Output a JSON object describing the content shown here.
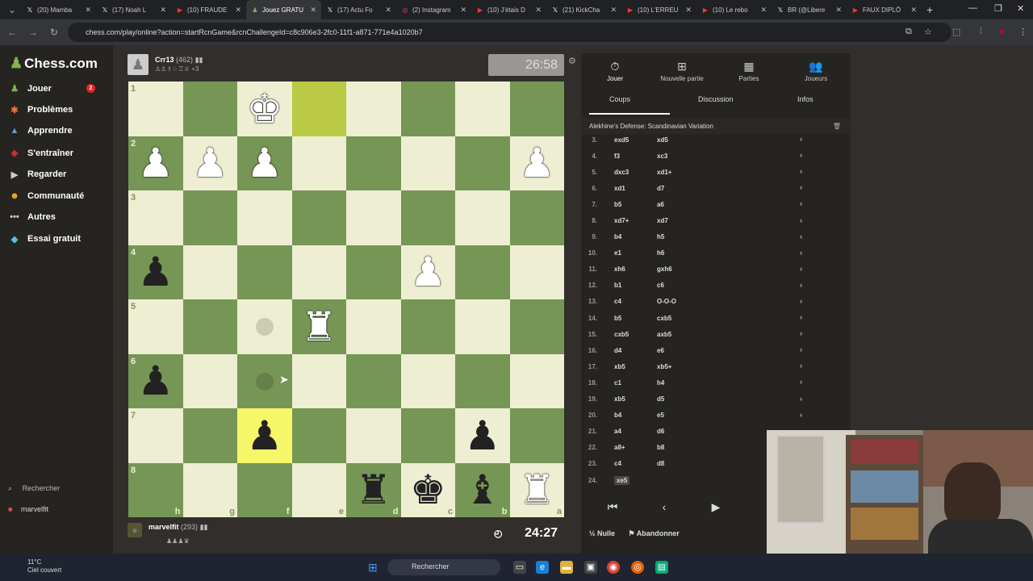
{
  "browser": {
    "tabs": [
      {
        "icon": "x-icon",
        "title": "(20) Mamba"
      },
      {
        "icon": "x-icon",
        "title": "(17) Noah L"
      },
      {
        "icon": "youtube-icon",
        "title": "(10) FRAUDE"
      },
      {
        "icon": "chess-icon",
        "title": "Jouez GRATU",
        "active": true
      },
      {
        "icon": "x-icon",
        "title": "(17) Actu Fo"
      },
      {
        "icon": "instagram-icon",
        "title": "(2) Instagram"
      },
      {
        "icon": "youtube-icon",
        "title": "(10) J'étais D"
      },
      {
        "icon": "x-icon",
        "title": "(21) KickCha"
      },
      {
        "icon": "youtube-icon",
        "title": "(10) L'ERREU"
      },
      {
        "icon": "youtube-icon",
        "title": "(10) Le rebo"
      },
      {
        "icon": "x-icon",
        "title": "BR (@Libere"
      },
      {
        "icon": "youtube-icon",
        "title": "FAUX DIPLÔ"
      }
    ],
    "url": "chess.com/play/online?action=startRcnGame&rcnChallengeId=c8c906e3-2fc0-11f1-a871-771e4a1020b7"
  },
  "sidebar": {
    "logo": "Chess.com",
    "items": [
      {
        "icon": "play-icon",
        "label": "Jouer",
        "badge": "2"
      },
      {
        "icon": "puzzle-icon",
        "label": "Problèmes"
      },
      {
        "icon": "learn-icon",
        "label": "Apprendre"
      },
      {
        "icon": "train-icon",
        "label": "S'entraîner"
      },
      {
        "icon": "watch-icon",
        "label": "Regarder"
      },
      {
        "icon": "community-icon",
        "label": "Communauté"
      },
      {
        "icon": "more-icon",
        "label": "Autres"
      },
      {
        "icon": "diamond-icon",
        "label": "Essai gratuit"
      }
    ],
    "search": "Rechercher",
    "username": "marvelfit"
  },
  "game": {
    "top_player": {
      "name": "Crr13",
      "rating": "(462)",
      "captured_more": "+3"
    },
    "top_clock": "26:58",
    "bottom_player": {
      "name": "marvelfit",
      "rating": "(293)"
    },
    "bottom_clock": "24:27",
    "rank_labels": [
      "1",
      "2",
      "3",
      "4",
      "5",
      "6",
      "7",
      "8"
    ],
    "file_labels": [
      "h",
      "g",
      "f",
      "e",
      "d",
      "c",
      "b",
      "a"
    ]
  },
  "board": {
    "white": [
      "f1:K",
      "h2:P",
      "g2:P",
      "f2:P",
      "a2:P",
      "c4:P",
      "e5:R",
      "a8:R"
    ],
    "black": [
      "h4:P",
      "h6:P",
      "f7:P",
      "b7:P",
      "d8:R",
      "c8:K",
      "b8:B"
    ],
    "highlight": [
      "e1"
    ],
    "highlight_yellow": [
      "f7"
    ],
    "move_hints": [
      "f5",
      "f6"
    ]
  },
  "panel": {
    "tabs": [
      {
        "icon": "clock-icon",
        "label": "Jouer"
      },
      {
        "icon": "plus-icon",
        "label": "Nouvelle partie"
      },
      {
        "icon": "games-icon",
        "label": "Parties"
      },
      {
        "icon": "players-icon",
        "label": "Joueurs"
      }
    ],
    "subtabs": [
      "Coups",
      "Discussion",
      "Infos"
    ],
    "opening": "Alekhine's Defense: Scandinavian Variation",
    "moves": [
      {
        "n": "3.",
        "w": "exd5",
        "b": "xd5"
      },
      {
        "n": "4.",
        "w": "f3",
        "b": "xc3"
      },
      {
        "n": "5.",
        "w": "dxc3",
        "b": "xd1+"
      },
      {
        "n": "6.",
        "w": "xd1",
        "b": "d7"
      },
      {
        "n": "7.",
        "w": "b5",
        "b": "a6"
      },
      {
        "n": "8.",
        "w": "xd7+",
        "b": "xd7"
      },
      {
        "n": "9.",
        "w": "b4",
        "b": "h5"
      },
      {
        "n": "10.",
        "w": "e1",
        "b": "h6"
      },
      {
        "n": "11.",
        "w": "xh6",
        "b": "gxh6"
      },
      {
        "n": "12.",
        "w": "b1",
        "b": "c6"
      },
      {
        "n": "13.",
        "w": "c4",
        "b": "O-O-O"
      },
      {
        "n": "14.",
        "w": "b5",
        "b": "cxb5"
      },
      {
        "n": "15.",
        "w": "cxb5",
        "b": "axb5"
      },
      {
        "n": "16.",
        "w": "d4",
        "b": "e6"
      },
      {
        "n": "17.",
        "w": "xb5",
        "b": "xb5+"
      },
      {
        "n": "18.",
        "w": "c1",
        "b": "h4"
      },
      {
        "n": "19.",
        "w": "xb5",
        "b": "d5"
      },
      {
        "n": "20.",
        "w": "b4",
        "b": "e5"
      },
      {
        "n": "21.",
        "w": "a4",
        "b": "d6"
      },
      {
        "n": "22.",
        "w": "a8+",
        "b": "b8"
      },
      {
        "n": "23.",
        "w": "c4",
        "b": "d8"
      },
      {
        "n": "24.",
        "w": "xe5",
        "b": ""
      }
    ],
    "draw_label": "Nulle",
    "resign_label": "Abandonner"
  },
  "taskbar": {
    "temp": "11°C",
    "weather": "Ciel couvert",
    "search": "Rechercher"
  },
  "colors": {
    "light": "#eeeed2",
    "dark": "#769656",
    "accent": "#81b64c"
  }
}
